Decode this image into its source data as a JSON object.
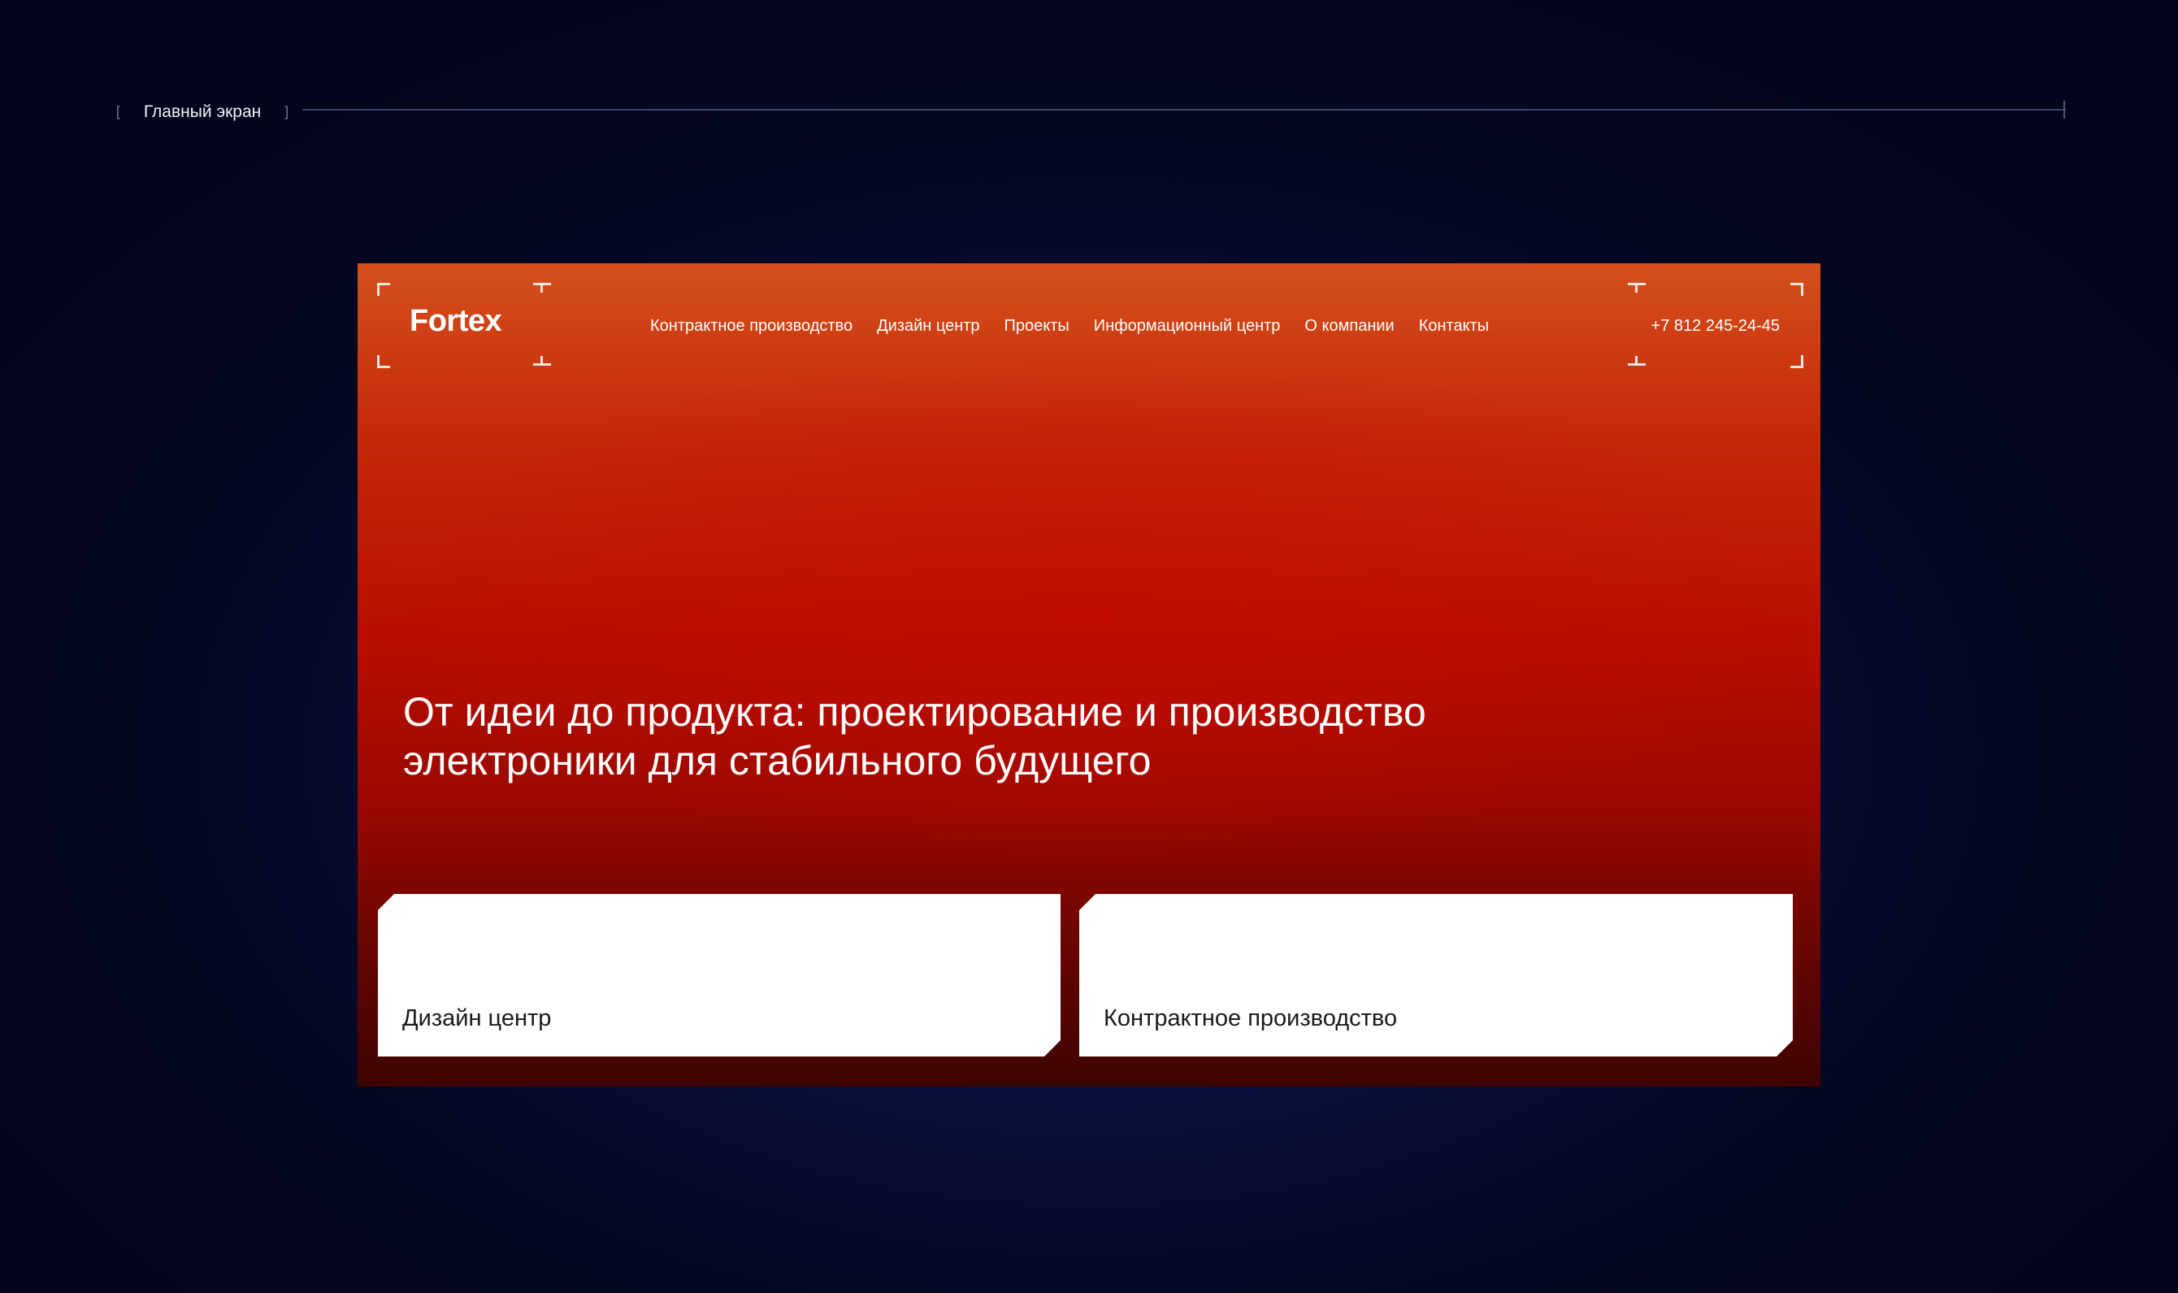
{
  "caption": {
    "label": "Главный экран",
    "open_bracket": "[",
    "close_bracket": "]"
  },
  "site": {
    "logo": "Fortex",
    "nav": [
      "Контрактное производство",
      "Дизайн центр",
      "Проекты",
      "Информационный центр",
      "О компании",
      "Контакты"
    ],
    "phone": "+7 812 245-24-45",
    "hero_title": "От идеи до продукта: проектирование и производство электроники для стабильного будущего",
    "cards": [
      "Дизайн центр",
      "Контрактное производство"
    ]
  },
  "colors": {
    "background": "#050822",
    "accent_top": "#d4501c",
    "accent_mid": "#b90e00",
    "accent_bottom": "#3c0402",
    "card": "#ffffff"
  }
}
